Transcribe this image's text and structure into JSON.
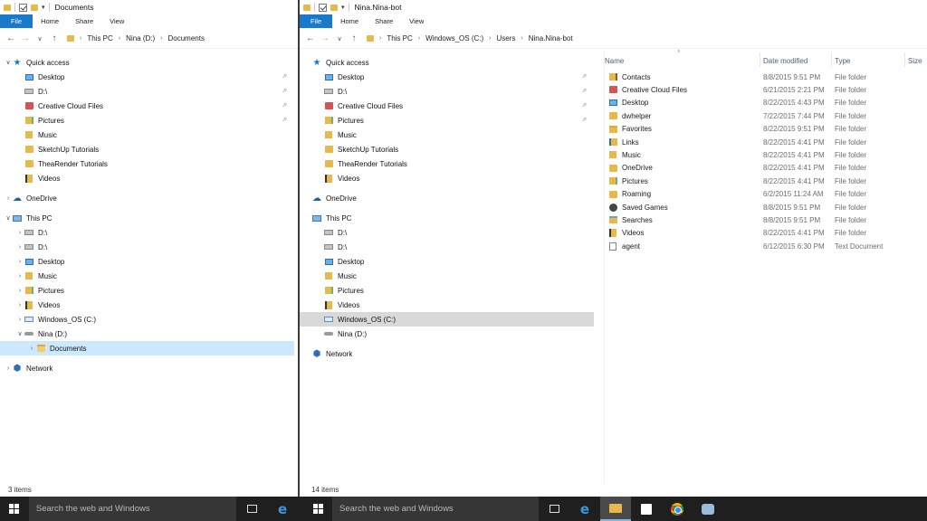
{
  "left_window": {
    "title": "Documents",
    "tabs": [
      "File",
      "Home",
      "Share",
      "View"
    ],
    "breadcrumb": [
      "This PC",
      "Nina (D:)",
      "Documents"
    ],
    "nav": [
      {
        "label": "Quick access",
        "icon": "star-icon",
        "chev": "v",
        "indent": 0
      },
      {
        "label": "Desktop",
        "icon": "desktop-icon",
        "pinned": true,
        "indent": 1
      },
      {
        "label": "D:\\",
        "icon": "drive-icon",
        "pinned": true,
        "indent": 1
      },
      {
        "label": "Creative Cloud Files",
        "icon": "creative-cloud-icon",
        "pinned": true,
        "indent": 1
      },
      {
        "label": "Pictures",
        "icon": "pictures-icon",
        "pinned": true,
        "indent": 1
      },
      {
        "label": "Music",
        "icon": "music-icon",
        "indent": 1
      },
      {
        "label": "SketchUp Tutorials",
        "icon": "folder-icon",
        "indent": 1
      },
      {
        "label": "TheaRender Tutorials",
        "icon": "folder-icon",
        "indent": 1
      },
      {
        "label": "Videos",
        "icon": "videos-icon",
        "indent": 1
      },
      {
        "label": "OneDrive",
        "icon": "onedrive-icon",
        "chev": ">",
        "indent": 0,
        "gap": true
      },
      {
        "label": "This PC",
        "icon": "this-pc-icon",
        "chev": "v",
        "indent": 0,
        "gap": true
      },
      {
        "label": "D:\\",
        "icon": "drive-icon",
        "chev": ">",
        "indent": 1
      },
      {
        "label": "D:\\",
        "icon": "drive-icon",
        "chev": ">",
        "indent": 1
      },
      {
        "label": "Desktop",
        "icon": "desktop-icon",
        "chev": ">",
        "indent": 1
      },
      {
        "label": "Music",
        "icon": "music-icon",
        "chev": ">",
        "indent": 1
      },
      {
        "label": "Pictures",
        "icon": "pictures-icon",
        "chev": ">",
        "indent": 1
      },
      {
        "label": "Videos",
        "icon": "videos-icon",
        "chev": ">",
        "indent": 1
      },
      {
        "label": "Windows_OS (C:)",
        "icon": "os-drive-icon",
        "chev": ">",
        "indent": 1
      },
      {
        "label": "Nina (D:)",
        "icon": "usb-drive-icon",
        "chev": "v",
        "indent": 1
      },
      {
        "label": "Documents",
        "icon": "open-folder-icon",
        "chev": ">",
        "indent": 2,
        "selected": true
      },
      {
        "label": "Network",
        "icon": "network-icon",
        "chev": ">",
        "indent": 0,
        "gap": true
      }
    ],
    "status": "3 items"
  },
  "right_window": {
    "title": "Nina.Nina-bot",
    "tabs": [
      "File",
      "Home",
      "Share",
      "View"
    ],
    "breadcrumb": [
      "This PC",
      "Windows_OS (C:)",
      "Users",
      "Nina.Nina-bot"
    ],
    "nav": [
      {
        "label": "Quick access",
        "icon": "star-icon",
        "indent": 0
      },
      {
        "label": "Desktop",
        "icon": "desktop-icon",
        "pinned": true,
        "indent": 1
      },
      {
        "label": "D:\\",
        "icon": "drive-icon",
        "pinned": true,
        "indent": 1
      },
      {
        "label": "Creative Cloud Files",
        "icon": "creative-cloud-icon",
        "pinned": true,
        "indent": 1
      },
      {
        "label": "Pictures",
        "icon": "pictures-icon",
        "pinned": true,
        "indent": 1
      },
      {
        "label": "Music",
        "icon": "music-icon",
        "indent": 1
      },
      {
        "label": "SketchUp Tutorials",
        "icon": "folder-icon",
        "indent": 1
      },
      {
        "label": "TheaRender Tutorials",
        "icon": "folder-icon",
        "indent": 1
      },
      {
        "label": "Videos",
        "icon": "videos-icon",
        "indent": 1
      },
      {
        "label": "OneDrive",
        "icon": "onedrive-icon",
        "indent": 0,
        "gap": true
      },
      {
        "label": "This PC",
        "icon": "this-pc-icon",
        "indent": 0,
        "gap": true
      },
      {
        "label": "D:\\",
        "icon": "drive-icon",
        "indent": 1
      },
      {
        "label": "D:\\",
        "icon": "drive-icon",
        "indent": 1
      },
      {
        "label": "Desktop",
        "icon": "desktop-icon",
        "indent": 1
      },
      {
        "label": "Music",
        "icon": "music-icon",
        "indent": 1
      },
      {
        "label": "Pictures",
        "icon": "pictures-icon",
        "indent": 1
      },
      {
        "label": "Videos",
        "icon": "videos-icon",
        "indent": 1
      },
      {
        "label": "Windows_OS (C:)",
        "icon": "os-drive-icon",
        "indent": 1,
        "hover": true
      },
      {
        "label": "Nina (D:)",
        "icon": "usb-drive-icon",
        "indent": 1
      },
      {
        "label": "Network",
        "icon": "network-icon",
        "indent": 0,
        "gap": true
      }
    ],
    "columns": [
      "Name",
      "Date modified",
      "Type",
      "Size"
    ],
    "files": [
      {
        "name": "Contacts",
        "date": "8/8/2015 9:51 PM",
        "type": "File folder",
        "icon": "contacts-folder-icon"
      },
      {
        "name": "Creative Cloud Files",
        "date": "6/21/2015 2:21 PM",
        "type": "File folder",
        "icon": "creative-cloud-icon"
      },
      {
        "name": "Desktop",
        "date": "8/22/2015 4:43 PM",
        "type": "File folder",
        "icon": "desktop-icon"
      },
      {
        "name": "dwhelper",
        "date": "7/22/2015 7:44 PM",
        "type": "File folder",
        "icon": "folder-icon"
      },
      {
        "name": "Favorites",
        "date": "8/22/2015 9:51 PM",
        "type": "File folder",
        "icon": "favorites-folder-icon"
      },
      {
        "name": "Links",
        "date": "8/22/2015 4:41 PM",
        "type": "File folder",
        "icon": "links-folder-icon"
      },
      {
        "name": "Music",
        "date": "8/22/2015 4:41 PM",
        "type": "File folder",
        "icon": "music-icon"
      },
      {
        "name": "OneDrive",
        "date": "8/22/2015 4:41 PM",
        "type": "File folder",
        "icon": "folder-icon"
      },
      {
        "name": "Pictures",
        "date": "8/22/2015 4:41 PM",
        "type": "File folder",
        "icon": "pictures-icon"
      },
      {
        "name": "Roaming",
        "date": "6/2/2015 11:24 AM",
        "type": "File folder",
        "icon": "folder-icon"
      },
      {
        "name": "Saved Games",
        "date": "8/8/2015 9:51 PM",
        "type": "File folder",
        "icon": "saved-games-icon"
      },
      {
        "name": "Searches",
        "date": "8/8/2015 9:51 PM",
        "type": "File folder",
        "icon": "searches-folder-icon"
      },
      {
        "name": "Videos",
        "date": "8/22/2015 4:41 PM",
        "type": "File folder",
        "icon": "videos-icon"
      },
      {
        "name": "agent",
        "date": "6/12/2015 6:30 PM",
        "type": "Text Document",
        "icon": "text-document-icon"
      }
    ],
    "status": "14 items"
  },
  "taskbar": {
    "search_placeholder": "Search the web and Windows",
    "accent": "#7db6e8",
    "background": "#1f1f1f"
  }
}
